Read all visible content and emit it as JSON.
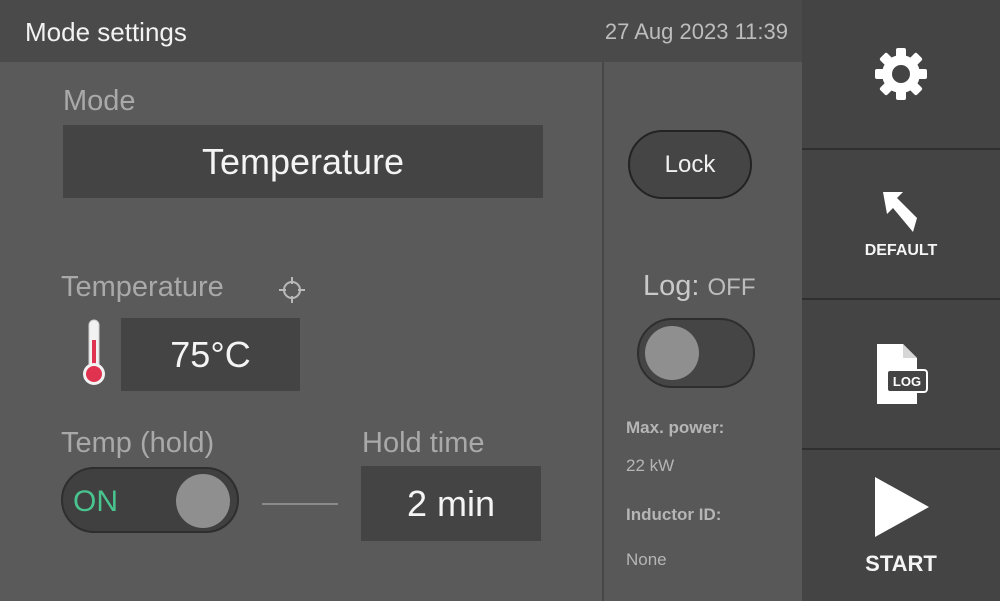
{
  "header": {
    "title": "Mode settings",
    "datetime": "27 Aug 2023 11:39"
  },
  "mode": {
    "label": "Mode",
    "value": "Temperature"
  },
  "temperature": {
    "label": "Temperature",
    "value": "75°C"
  },
  "temp_hold": {
    "label": "Temp (hold)",
    "toggle_text": "ON",
    "on": true
  },
  "hold_time": {
    "label": "Hold time",
    "value": "2 min"
  },
  "lock": {
    "label": "Lock"
  },
  "log": {
    "label": "Log:",
    "state": "OFF",
    "on": false
  },
  "info": {
    "max_power_label": "Max. power:",
    "max_power_value": "22 kW",
    "inductor_label": "Inductor ID:",
    "inductor_value": "None"
  },
  "rail": {
    "settings_icon": "gear-icon",
    "default_label": "DEFAULT",
    "default_icon": "undo-arrow-icon",
    "log_icon_text": "LOG",
    "start_label": "START",
    "start_icon": "play-icon"
  },
  "colors": {
    "accent_on": "#49c48f",
    "thermometer": "#e0334f",
    "background": "#5a5a5a",
    "field": "#444444"
  }
}
